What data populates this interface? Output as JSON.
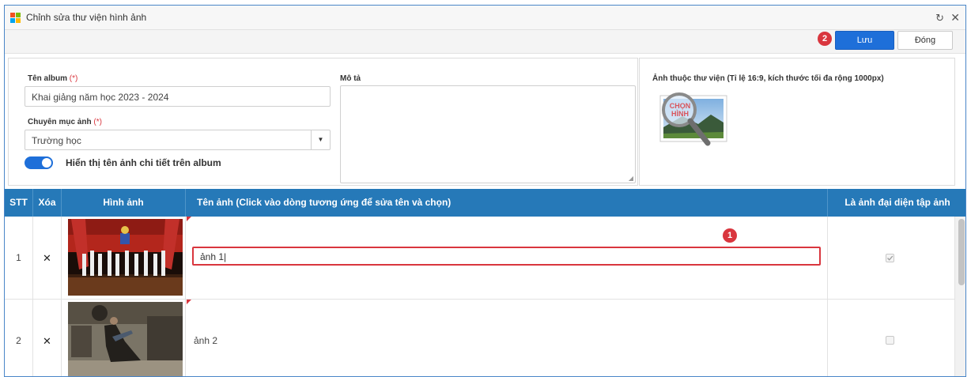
{
  "window": {
    "title": "Chỉnh sửa thư viện hình ảnh",
    "refresh_icon": "refresh-icon",
    "close_icon": "close-icon",
    "close_glyph": "✕",
    "refresh_glyph": "↻"
  },
  "toolbar": {
    "step_badge": "2",
    "save_label": "Lưu",
    "close_label": "Đóng"
  },
  "form": {
    "album_name_label": "Tên album",
    "album_name_required": "(*)",
    "album_name_value": "Khai giảng năm học 2023 - 2024",
    "category_label": "Chuyên mục ảnh",
    "category_required": "(*)",
    "category_value": "Trường học",
    "category_arrow": "▼",
    "toggle_label": "Hiển thị tên ảnh chi tiết trên album",
    "toggle_on": true,
    "description_label": "Mô tả",
    "description_value": "",
    "library_image_label": "Ảnh thuộc thư viện (Tỉ lệ 16:9, kích thước tối đa rộng 1000px)",
    "chooser_text": "CHỌN HÌNH"
  },
  "grid": {
    "headers": {
      "stt": "STT",
      "delete": "Xóa",
      "image": "Hình ảnh",
      "name": "Tên ảnh (Click vào dòng tương ứng để sửa tên và chọn)",
      "cover": "Là ảnh đại diện tập ảnh"
    },
    "rows": [
      {
        "stt": "1",
        "delete": "✕",
        "name": "ảnh 1",
        "editing": true,
        "is_cover": true
      },
      {
        "stt": "2",
        "delete": "✕",
        "name": "ảnh 2",
        "editing": false,
        "is_cover": false
      }
    ],
    "edit_badge": "1"
  },
  "colors": {
    "header_blue": "#2679b8",
    "primary_blue": "#1e6fd9",
    "badge_red": "#d9363e",
    "window_border": "#4a86c8"
  }
}
